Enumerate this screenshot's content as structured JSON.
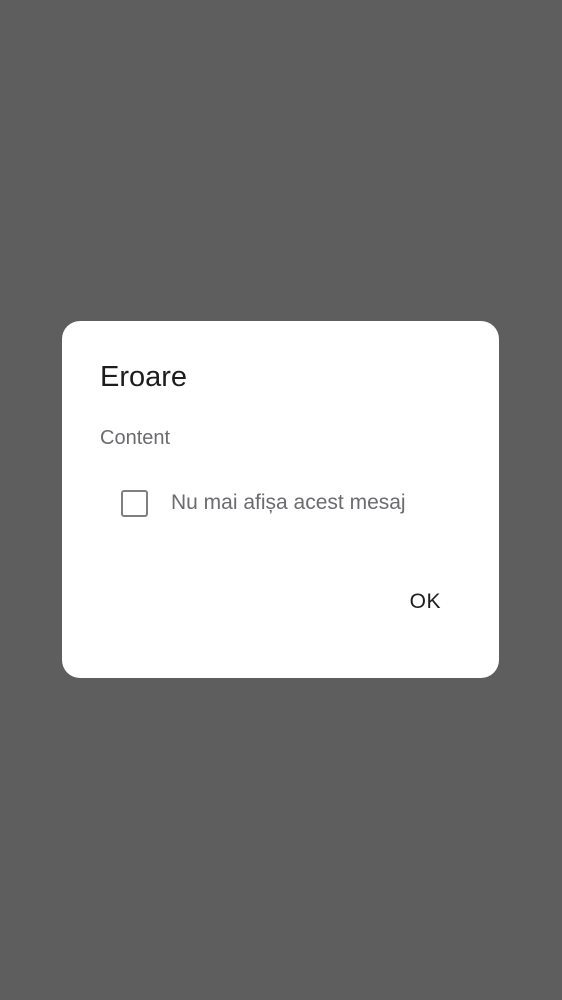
{
  "dialog": {
    "title": "Eroare",
    "content": "Content",
    "checkbox": {
      "label": "Nu mai afișa acest mesaj",
      "checked": false
    },
    "ok_label": "OK"
  },
  "colors": {
    "scrim": "#5e5e5e",
    "dialog_background": "#ffffff",
    "title_text": "#1d1d1f",
    "secondary_text": "#6b6b70",
    "checkbox_border": "#7c7f85"
  }
}
